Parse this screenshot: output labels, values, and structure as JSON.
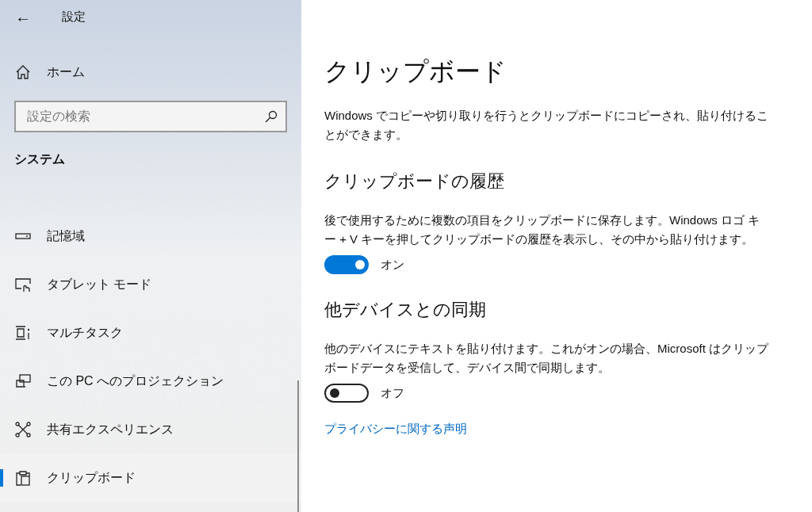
{
  "sidebar": {
    "back": "←",
    "title": "設定",
    "home": "ホーム",
    "search": {
      "placeholder": "設定の検索"
    },
    "section": "システム",
    "items": [
      {
        "kind": "storage",
        "label": "記憶域",
        "selected": false
      },
      {
        "kind": "tablet",
        "label": "タブレット モード",
        "selected": false
      },
      {
        "kind": "multitask",
        "label": "マルチタスク",
        "selected": false
      },
      {
        "kind": "projection",
        "label": "この PC へのプロジェクション",
        "selected": false
      },
      {
        "kind": "shared",
        "label": "共有エクスペリエンス",
        "selected": false
      },
      {
        "kind": "clipboard",
        "label": "クリップボード",
        "selected": true
      }
    ]
  },
  "page": {
    "title": "クリップボード",
    "description": "Windows でコピーや切り取りを行うとクリップボードにコピーされ、貼り付けることができます。",
    "sections": [
      {
        "heading": "クリップボードの履歴",
        "description": "後で使用するために複数の項目をクリップボードに保存します。Windows ロゴ キー + V キーを押してクリップボードの履歴を表示し、その中から貼り付けます。",
        "on": true,
        "state_label": "オン"
      },
      {
        "heading": "他デバイスとの同期",
        "description": "他のデバイスにテキストを貼り付けます。これがオンの場合、Microsoft はクリップボードデータを受信して、デバイス間で同期します。",
        "on": false,
        "state_label": "オフ"
      }
    ],
    "link": "プライバシーに関する声明"
  }
}
